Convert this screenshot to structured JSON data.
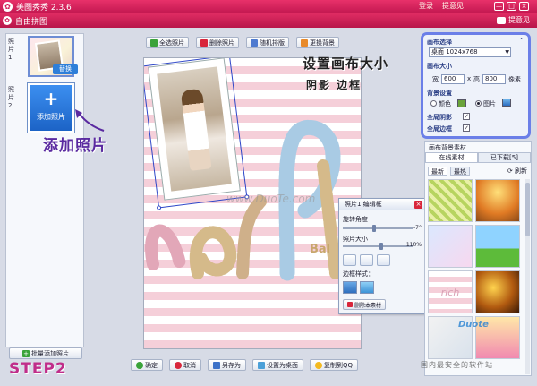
{
  "app": {
    "title": "美图秀秀 2.3.6",
    "menu": [
      "登录",
      "提意见"
    ],
    "controls": [
      "—",
      "□",
      "×"
    ]
  },
  "dialog": {
    "title": "自由拼图",
    "feedback": "提意见"
  },
  "left": {
    "slot1": "照片1",
    "slot2": "照片2",
    "replace": "替换",
    "add_photo": "添加照片",
    "batch_add": "批量添加照片"
  },
  "annotations": {
    "add_photo": "添加照片",
    "canvas_size": "设置画布大小",
    "shadow_border": "阴影 边框",
    "step": "STEP2"
  },
  "toolbar": {
    "select_all": "全选照片",
    "delete": "删除照片",
    "random_layout": "随机排版",
    "change_bg": "更换背景"
  },
  "canvas": {
    "watermark": "www.DuoTe.com",
    "text": "Bal"
  },
  "frame_editor": {
    "title": "照片1 编辑框",
    "rotate_label": "旋转角度",
    "rotate_value": "-7°",
    "rotate_fraction": 0.45,
    "size_label": "照片大小",
    "size_value": "110%",
    "size_fraction": 0.55,
    "border_style": "边框样式：",
    "delete_material": "删除本素材"
  },
  "bottom": {
    "ok": "确定",
    "cancel": "取消",
    "save_as": "另存为",
    "set_wallpaper": "设置为桌面",
    "copy_qq": "复制到QQ"
  },
  "canvas_settings": {
    "title": "画布选择",
    "preset": "桌面  1024x768",
    "size_title": "画布大小",
    "width_label": "宽",
    "width": "600",
    "x": "x",
    "height_label": "高",
    "height": "800",
    "unit": "像素",
    "bg_title": "背景设置",
    "color_label": "颜色",
    "image_label": "图片",
    "shadow_label": "全局阴影",
    "border_label": "全局边框",
    "check": "✓",
    "collapse": "⌃"
  },
  "materials": {
    "title": "画布背景素材",
    "tab_online": "在线素材",
    "tab_downloaded": "已下载[5]",
    "sort_new": "最新",
    "sort_hot": "最热",
    "refresh": "刷新",
    "tile_text": "rich"
  },
  "site_watermarks": {
    "w1": "Duote",
    "w2": "国内最安全的软件站"
  },
  "colors": {
    "accent_pink": "#d11d58",
    "frame_blue": "#2f47c8",
    "settings_border": "#6b7fe8"
  }
}
